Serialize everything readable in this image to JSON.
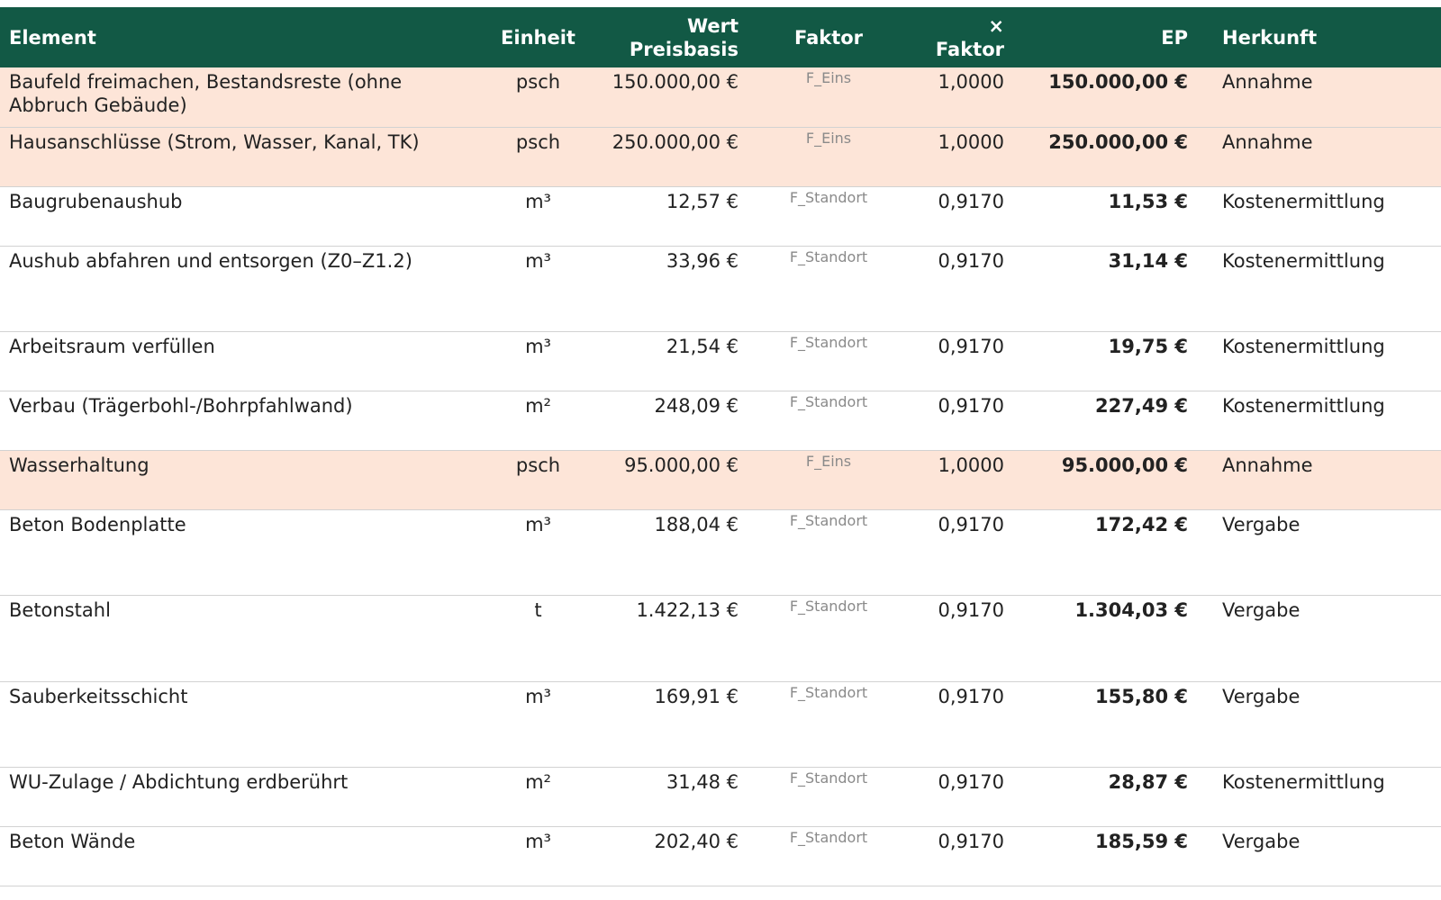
{
  "table": {
    "headers": {
      "element": "Element",
      "einheit": "Einheit",
      "wert": "Wert\nPreisbasis",
      "faktor": "Faktor",
      "xfaktor": "× Faktor",
      "ep": "EP",
      "herkunft": "Herkunft"
    },
    "rows": [
      {
        "element": "Baufeld freimachen, Bestandsreste (ohne Abbruch Gebäude)",
        "einheit": "psch",
        "wert": "150.000,00 €",
        "faktor": "F_Eins",
        "xfaktor": "1,0000",
        "ep": "150.000,00 €",
        "herkunft": "Annahme",
        "height": 66
      },
      {
        "element": "Hausanschlüsse (Strom, Wasser, Kanal, TK)",
        "einheit": "psch",
        "wert": "250.000,00 €",
        "faktor": "F_Eins",
        "xfaktor": "1,0000",
        "ep": "250.000,00 €",
        "herkunft": "Annahme",
        "height": 66
      },
      {
        "element": "Baugrubenaushub",
        "einheit": "m³",
        "wert": "12,57 €",
        "faktor": "F_Standort",
        "xfaktor": "0,9170",
        "ep": "11,53 €",
        "herkunft": "Kostenermittlung",
        "height": 66
      },
      {
        "element": "Aushub abfahren und entsorgen (Z0–Z1.2)",
        "einheit": "m³",
        "wert": "33,96 €",
        "faktor": "F_Standort",
        "xfaktor": "0,9170",
        "ep": "31,14 €",
        "herkunft": "Kostenermittlung",
        "height": 95
      },
      {
        "element": "Arbeitsraum verfüllen",
        "einheit": "m³",
        "wert": "21,54 €",
        "faktor": "F_Standort",
        "xfaktor": "0,9170",
        "ep": "19,75 €",
        "herkunft": "Kostenermittlung",
        "height": 66
      },
      {
        "element": "Verbau (Trägerbohl-/Bohrpfahlwand)",
        "einheit": "m²",
        "wert": "248,09 €",
        "faktor": "F_Standort",
        "xfaktor": "0,9170",
        "ep": "227,49 €",
        "herkunft": "Kostenermittlung",
        "height": 66
      },
      {
        "element": "Wasserhaltung",
        "einheit": "psch",
        "wert": "95.000,00 €",
        "faktor": "F_Eins",
        "xfaktor": "1,0000",
        "ep": "95.000,00 €",
        "herkunft": "Annahme",
        "height": 66
      },
      {
        "element": "Beton Bodenplatte",
        "einheit": "m³",
        "wert": "188,04 €",
        "faktor": "F_Standort",
        "xfaktor": "0,9170",
        "ep": "172,42 €",
        "herkunft": "Vergabe",
        "height": 95
      },
      {
        "element": "Betonstahl",
        "einheit": "t",
        "wert": "1.422,13 €",
        "faktor": "F_Standort",
        "xfaktor": "0,9170",
        "ep": "1.304,03 €",
        "herkunft": "Vergabe",
        "height": 96
      },
      {
        "element": "Sauberkeitsschicht",
        "einheit": "m³",
        "wert": "169,91 €",
        "faktor": "F_Standort",
        "xfaktor": "0,9170",
        "ep": "155,80 €",
        "herkunft": "Vergabe",
        "height": 95
      },
      {
        "element": "WU-Zulage / Abdichtung erdberührt",
        "einheit": "m²",
        "wert": "31,48 €",
        "faktor": "F_Standort",
        "xfaktor": "0,9170",
        "ep": "28,87 €",
        "herkunft": "Kostenermittlung",
        "height": 66
      },
      {
        "element": "Beton Wände",
        "einheit": "m³",
        "wert": "202,40 €",
        "faktor": "F_Standort",
        "xfaktor": "0,9170",
        "ep": "185,59 €",
        "herkunft": "Vergabe",
        "height": 66
      }
    ]
  },
  "colors": {
    "header_bg": "#125945",
    "assumption_row_bg": "#fde5d8",
    "row_divider": "#d2d2d2"
  }
}
